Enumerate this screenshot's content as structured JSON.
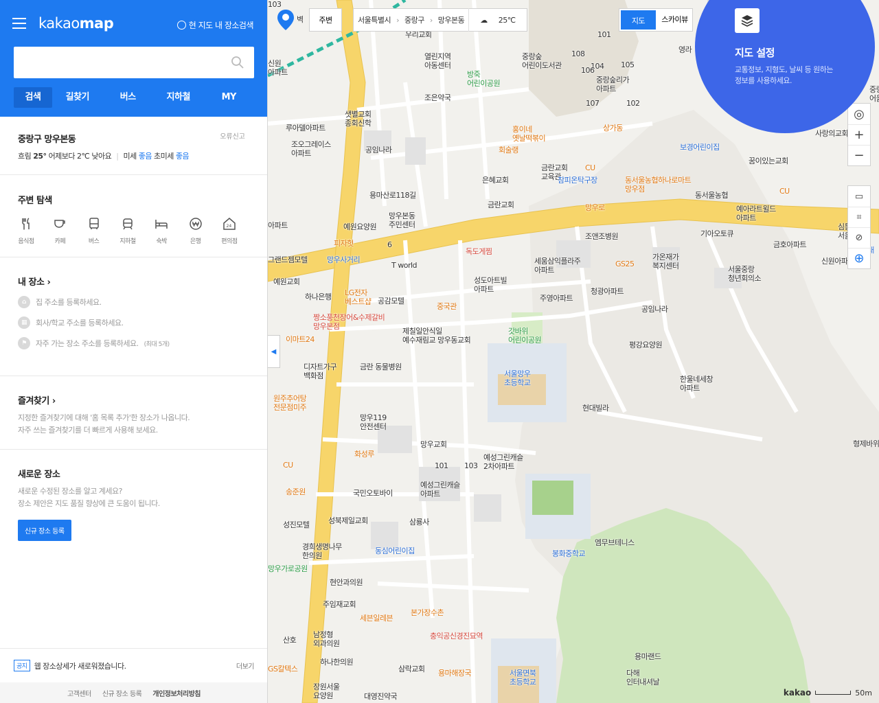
{
  "sidebar": {
    "logo": {
      "a": "kakao",
      "b": "map"
    },
    "only_map_search": "현 지도 내 장소검색",
    "search_placeholder": "",
    "tabs": [
      "검색",
      "길찾기",
      "버스",
      "지하철",
      "MY"
    ],
    "location": {
      "name": "중랑구 망우본동",
      "report": "오류신고",
      "weather": "흐림",
      "temp": "25°",
      "compare": "어제보다 2℃ 낮아요",
      "fine_dust_label": "미세",
      "fine_dust_value": "좋음",
      "ultra_dust_label": "초미세",
      "ultra_dust_value": "좋음"
    },
    "nearby": {
      "title": "주변 탐색",
      "cats": [
        "음식점",
        "카페",
        "버스",
        "지하철",
        "숙박",
        "은행",
        "편의점"
      ]
    },
    "myplace": {
      "title": "내 장소",
      "home": "집 주소를 등록하세요.",
      "work": "회사/학교 주소를 등록하세요.",
      "freq": "자주 가는 장소 주소를 등록하세요.",
      "freq_note": "(최대 5개)"
    },
    "favorite": {
      "title": "즐겨찾기",
      "desc1": "지정한 즐겨찾기에 대해 '홈 목록 추가'한 장소가 나옵니다.",
      "desc2": "자주 쓰는 즐겨찾기를 더 빠르게 사용해 보세요."
    },
    "newplace": {
      "title": "새로운 장소",
      "desc1": "새로운 수정된 장소를 알고 계세요?",
      "desc2": "장소 제안은 지도 품질 향상에 큰 도움이 됩니다.",
      "button": "신규 장소 등록"
    },
    "notice": {
      "tag": "공지",
      "text": "웹 장소상세가 새로워졌습니다.",
      "more": "더보기"
    },
    "footer": [
      "고객센터",
      "신규 장소 등록",
      "개인정보처리방침"
    ]
  },
  "map": {
    "nearby_btn": "주변",
    "crumbs": [
      "서울특별시",
      "중랑구",
      "망우본동"
    ],
    "temp": "25℃",
    "mode": [
      "지도",
      "스카이뷰"
    ],
    "setting_title": "지도 설정",
    "setting_desc": "교통정보, 지형도, 날씨 등 원하는 정보를 사용하세요.",
    "scale": "50m",
    "brand": "kakao",
    "labels": [
      {
        "t": "우리교회",
        "c": ""
      },
      {
        "t": "열린지역\n아동센터",
        "c": ""
      },
      {
        "t": "방죽\n어린이공원",
        "c": "g"
      },
      {
        "t": "조은약국",
        "c": ""
      },
      {
        "t": "중랑숲\n어린이도서관",
        "c": ""
      },
      {
        "t": "중랑숲리가\n아파트",
        "c": ""
      },
      {
        "t": "상가동",
        "c": "o"
      },
      {
        "t": "루아델아파트",
        "c": ""
      },
      {
        "t": "조오그레이스\n아파트",
        "c": ""
      },
      {
        "t": "샛별교회\n종회신학",
        "c": ""
      },
      {
        "t": "공임나라",
        "c": ""
      },
      {
        "t": "홍이네\n옛날떡볶이",
        "c": "o"
      },
      {
        "t": "회술랭",
        "c": "o"
      },
      {
        "t": "금란교회\n교육관",
        "c": ""
      },
      {
        "t": "은혜교회",
        "c": ""
      },
      {
        "t": "금란교회",
        "c": ""
      },
      {
        "t": "참피온탁구장",
        "c": "b"
      },
      {
        "t": "CU",
        "c": "o"
      },
      {
        "t": "동서울농협하나로마트\n망우점",
        "c": "o"
      },
      {
        "t": "보경어린이집",
        "c": "b"
      },
      {
        "t": "꿈이있는교회",
        "c": ""
      },
      {
        "t": "사랑의교회",
        "c": ""
      },
      {
        "t": "동서울농협",
        "c": ""
      },
      {
        "t": "CU",
        "c": "o"
      },
      {
        "t": "예아라트윌드\n아파트",
        "c": ""
      },
      {
        "t": "용마산로118길",
        "c": ""
      },
      {
        "t": "망우본동\n주민센터",
        "c": ""
      },
      {
        "t": "예원요양원",
        "c": ""
      },
      {
        "t": "망우로",
        "c": "o"
      },
      {
        "t": "조앤조병원",
        "c": ""
      },
      {
        "t": "기아오토큐",
        "c": ""
      },
      {
        "t": "금호아파트",
        "c": ""
      },
      {
        "t": "피자헛",
        "c": "o"
      },
      {
        "t": "망우사거리",
        "c": "b"
      },
      {
        "t": "T world",
        "c": ""
      },
      {
        "t": "독도게찜",
        "c": "r"
      },
      {
        "t": "세움삼익플라주\n아파트",
        "c": ""
      },
      {
        "t": "GS25",
        "c": "o"
      },
      {
        "t": "가온재가\n복지센터",
        "c": ""
      },
      {
        "t": "서울중랑\n청년회의소",
        "c": ""
      },
      {
        "t": "신원아파트",
        "c": ""
      },
      {
        "t": "그랜드젬모텔",
        "c": ""
      },
      {
        "t": "예원교회",
        "c": ""
      },
      {
        "t": "하나은행",
        "c": ""
      },
      {
        "t": "LG전자\n베스트샵",
        "c": "o"
      },
      {
        "t": "공감모텔",
        "c": ""
      },
      {
        "t": "중국관",
        "c": "o"
      },
      {
        "t": "성도아트빌\n아파트",
        "c": ""
      },
      {
        "t": "주영아파트",
        "c": ""
      },
      {
        "t": "청광아파트",
        "c": ""
      },
      {
        "t": "공임나라",
        "c": ""
      },
      {
        "t": "짱소풍천장어&수제갈비\n망우본점",
        "c": "r"
      },
      {
        "t": "제칠일안식일\n예수재림교 망우동교회",
        "c": ""
      },
      {
        "t": "갓바위\n어린이공원",
        "c": "g"
      },
      {
        "t": "평강요양원",
        "c": ""
      },
      {
        "t": "이마트24",
        "c": "o"
      },
      {
        "t": "디자트가구\n백화점",
        "c": ""
      },
      {
        "t": "금란 동물병원",
        "c": ""
      },
      {
        "t": "서울망우\n초등학교",
        "c": "b"
      },
      {
        "t": "한울네세창\n아파트",
        "c": ""
      },
      {
        "t": "원주추어탕\n전문점미주",
        "c": "o"
      },
      {
        "t": "현대빌라",
        "c": ""
      },
      {
        "t": "망우119\n안전센터",
        "c": ""
      },
      {
        "t": "망우교회",
        "c": ""
      },
      {
        "t": "형제바위",
        "c": ""
      },
      {
        "t": "화성루",
        "c": "o"
      },
      {
        "t": "예성그린캐슬\n2차아파트",
        "c": ""
      },
      {
        "t": "CU",
        "c": "o"
      },
      {
        "t": "송준원",
        "c": "o"
      },
      {
        "t": "국민오토바이",
        "c": ""
      },
      {
        "t": "예성그린캐슬\n아파트",
        "c": ""
      },
      {
        "t": "성진모텔",
        "c": ""
      },
      {
        "t": "성북제일교회",
        "c": ""
      },
      {
        "t": "삼룡사",
        "c": ""
      },
      {
        "t": "경희생명나무\n한의원",
        "c": ""
      },
      {
        "t": "동심어린이집",
        "c": "b"
      },
      {
        "t": "엠무브테니스",
        "c": ""
      },
      {
        "t": "봉화중학교",
        "c": "b"
      },
      {
        "t": "망우가로공원",
        "c": "g"
      },
      {
        "t": "현안과의원",
        "c": ""
      },
      {
        "t": "주임재교회",
        "c": ""
      },
      {
        "t": "본가장수촌",
        "c": "o"
      },
      {
        "t": "세븐일레븐",
        "c": "o"
      },
      {
        "t": "충익공신경진묘역",
        "c": "r"
      },
      {
        "t": "남정형\n외과의원",
        "c": ""
      },
      {
        "t": "산호",
        "c": ""
      },
      {
        "t": "하나한의원",
        "c": ""
      },
      {
        "t": "GS칼텍스",
        "c": "o"
      },
      {
        "t": "삼락교회",
        "c": ""
      },
      {
        "t": "용마해장국",
        "c": "o"
      },
      {
        "t": "서울면북\n초등학교",
        "c": "b"
      },
      {
        "t": "용마랜드",
        "c": ""
      },
      {
        "t": "다해\n인터내셔날",
        "c": ""
      },
      {
        "t": "장원서울\n요양원",
        "c": ""
      },
      {
        "t": "대영진약국",
        "c": ""
      },
      {
        "t": "심통누\n서울점",
        "c": ""
      },
      {
        "t": "송곡대",
        "c": "b"
      },
      {
        "t": "아파트",
        "c": ""
      },
      {
        "t": "벽",
        "c": ""
      },
      {
        "t": "신원\n아파트",
        "c": ""
      },
      {
        "t": "중랑\n어울림",
        "c": ""
      },
      {
        "t": "영라",
        "c": ""
      },
      {
        "t": "6",
        "c": ""
      },
      {
        "t": "101",
        "c": ""
      },
      {
        "t": "102",
        "c": ""
      },
      {
        "t": "103",
        "c": ""
      },
      {
        "t": "104",
        "c": ""
      },
      {
        "t": "105",
        "c": ""
      },
      {
        "t": "106",
        "c": ""
      },
      {
        "t": "107",
        "c": ""
      },
      {
        "t": "108",
        "c": ""
      },
      {
        "t": "101",
        "c": ""
      },
      {
        "t": "103",
        "c": ""
      }
    ]
  },
  "colors": {
    "accent": "#1e7af0",
    "setting_bg": "#3d66e8",
    "road": "#f7d56a",
    "green": "#c9e5b4"
  }
}
